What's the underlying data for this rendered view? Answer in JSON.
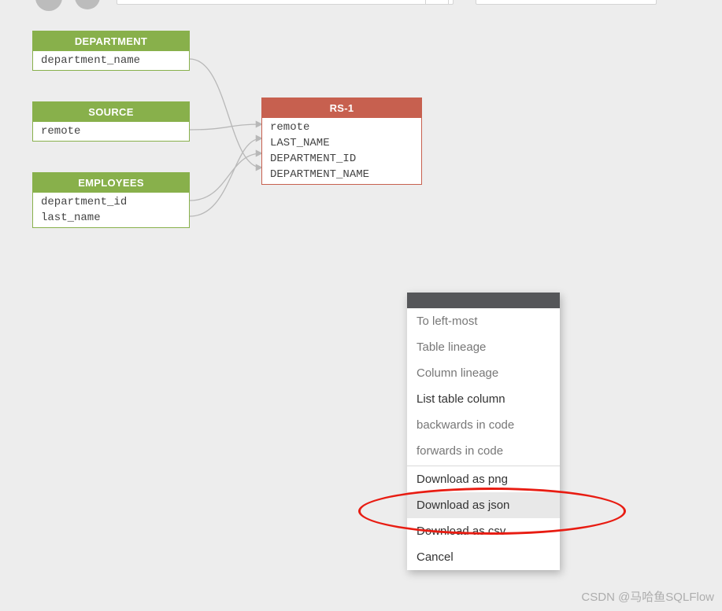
{
  "nodes": {
    "department": {
      "header": "DEPARTMENT",
      "fields": [
        "department_name"
      ]
    },
    "source": {
      "header": "SOURCE",
      "fields": [
        "remote"
      ]
    },
    "employees": {
      "header": "EMPLOYEES",
      "fields": [
        "department_id",
        "last_name"
      ]
    },
    "rs1": {
      "header": "RS-1",
      "fields": [
        "remote",
        "LAST_NAME",
        "DEPARTMENT_ID",
        "DEPARTMENT_NAME"
      ]
    }
  },
  "context_menu": {
    "items": [
      {
        "label": "To left-most",
        "style": "normal"
      },
      {
        "label": "Table lineage",
        "style": "normal"
      },
      {
        "label": "Column lineage",
        "style": "normal"
      },
      {
        "label": "List table column",
        "style": "dark"
      },
      {
        "label": "backwards in code",
        "style": "normal"
      },
      {
        "label": "forwards in code",
        "style": "normal"
      }
    ],
    "downloads": [
      {
        "label": "Download as png",
        "style": "dark"
      },
      {
        "label": "Download as json",
        "style": "hover"
      },
      {
        "label": "Download as csv",
        "style": "dark"
      },
      {
        "label": "Cancel",
        "style": "dark"
      }
    ]
  },
  "watermark": "CSDN @马哈鱼SQLFlow"
}
